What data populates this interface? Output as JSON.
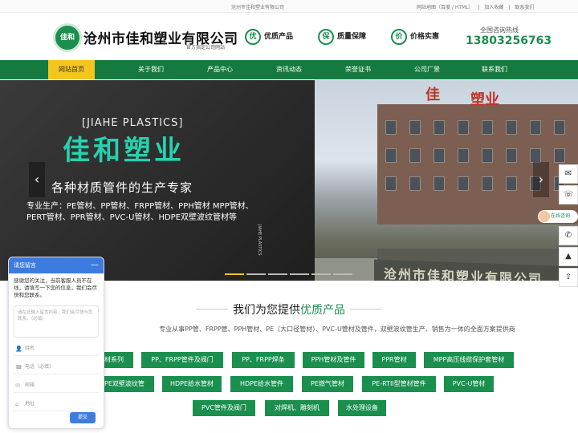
{
  "topbar": {
    "site_name": "沧州市佳和塑业有限公司",
    "links": [
      "网站地图（百度 / HTML）",
      "|",
      "加入收藏",
      "|",
      "联系我们"
    ]
  },
  "header": {
    "logo_text": "佳和",
    "company_name": "沧州市佳和塑业有限公司",
    "tagline": "官方指定公司网站",
    "features": [
      {
        "icon": "优",
        "label": "优质产品"
      },
      {
        "icon": "保",
        "label": "质量保障"
      },
      {
        "icon": "价",
        "label": "价格实惠"
      }
    ],
    "hotline_label": "全国咨询热线",
    "hotline": "13803256763"
  },
  "nav": {
    "items": [
      "网站首页",
      "关于我们",
      "产品中心",
      "资讯动态",
      "荣誉证书",
      "公司厂景",
      "联系我们"
    ],
    "active_index": 0
  },
  "banner": {
    "eng_title": "[JIAHE PLASTICS]",
    "cn_title": "佳和塑业",
    "slogan": "各种材质管件的生产专家",
    "desc": "专业生产：PE管材、PP管材、FRPP管材、PPH管材 MPP管材、PERT管材、PPR管材、PVC-U管材、HDPE双壁波纹管材等",
    "vertical_text": "JIAHE PLASTICS",
    "sign_text": "沧州市佳和塑业有限公司",
    "roof_text_1": "佳",
    "roof_text_2": "塑业",
    "prev": "‹",
    "next": "›",
    "slide_count": 6,
    "active_slide": 0
  },
  "side": {
    "qq": "✉",
    "wechat": "☏",
    "online_label": "在线咨询",
    "phone": "✆",
    "top": "▲",
    "share": "⇪"
  },
  "section": {
    "title_prefix": "我们为您提供",
    "title_highlight": "优质产品",
    "desc": "专业从事PP管、FRPP管、PPH管材、PE（大口径管材）、PVC-U管材及管件，双壁波纹管生产、销售为一体的全面方案提供商",
    "tags_row1": [
      "材系列",
      "PP、FRPP管件及阀门",
      "PP、FRPP焊条",
      "PPH管材及管件",
      "PPR管材",
      "MPP高压线缆保护套管材"
    ],
    "tags_row2": [
      "PE双壁波纹管",
      "HDPE给水管材",
      "HDPE给水管件",
      "PE燃气管材",
      "PE-RTII型管材管件",
      "PVC-U管材"
    ],
    "tags_row3": [
      "PVC管件及阀门",
      "对焊机、雕刻机",
      "水处理设备"
    ]
  },
  "chat": {
    "title": "请您留言",
    "minimize": "—",
    "message": "感谢您的关注，当前客服人员不在线，请填写一下您的信息，我们会尽快和您联系。",
    "textarea_placeholder": "请在此输入留言内容，我们会尽快与您联系。（必填）",
    "fields": [
      {
        "icon": "👤",
        "placeholder": "姓名"
      },
      {
        "icon": "☎",
        "placeholder": "电话（必填）"
      },
      {
        "icon": "✉",
        "placeholder": "邮箱"
      },
      {
        "icon": "⌂",
        "placeholder": "地址"
      }
    ],
    "submit": "提交"
  },
  "colors": {
    "brand_green": "#1a8f4e",
    "nav_green": "#157a3f",
    "accent_yellow": "#f4c51f",
    "chat_blue": "#3e7be0"
  }
}
